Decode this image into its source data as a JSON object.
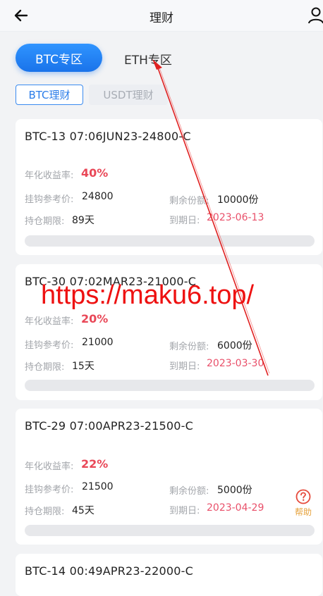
{
  "header": {
    "title": "理财"
  },
  "zone_tabs": [
    {
      "label": "BTC专区",
      "active": true
    },
    {
      "label": "ETH专区",
      "active": false
    }
  ],
  "sub_tabs": [
    {
      "label": "BTC理财",
      "active": true
    },
    {
      "label": "USDT理财",
      "active": false
    }
  ],
  "labels": {
    "yield": "年化收益率:",
    "ref_price": "挂钩参考价:",
    "remaining": "剩余份额:",
    "term": "持仓期限:",
    "expiry": "到期日:"
  },
  "products": [
    {
      "name": "BTC-13 07:06JUN23-24800-C",
      "yield": "40%",
      "ref_price": "24800",
      "remaining": "10000份",
      "term": "89天",
      "expiry": "2023-06-13",
      "progress": 0.0
    },
    {
      "name": "BTC-30 07:02MAR23-21000-C",
      "yield": "20%",
      "ref_price": "21000",
      "remaining": "6000份",
      "term": "15天",
      "expiry": "2023-03-30",
      "progress": 0.0
    },
    {
      "name": "BTC-29 07:00APR23-21500-C",
      "yield": "22%",
      "ref_price": "21500",
      "remaining": "5000份",
      "term": "45天",
      "expiry": "2023-04-29",
      "progress": 0.0
    },
    {
      "name": "BTC-14 00:49APR23-22000-C"
    }
  ],
  "help": {
    "label": "帮助"
  },
  "watermark": "https://maku6.top/",
  "colors": {
    "accent": "#1a73ea",
    "yield": "#e94757",
    "expiry": "#e9506a",
    "help": "#e6a23c",
    "watermark": "#ee1111"
  }
}
